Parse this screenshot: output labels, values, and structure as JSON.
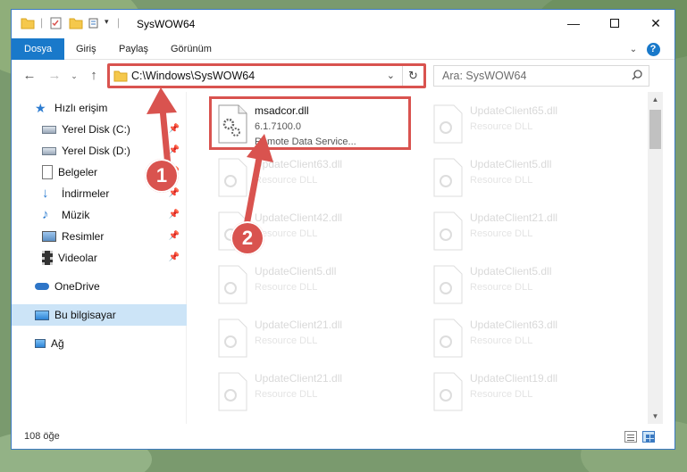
{
  "window": {
    "title": "SysWOW64"
  },
  "ribbon": {
    "tabs": [
      {
        "label": "Dosya",
        "active": true
      },
      {
        "label": "Giriş",
        "active": false
      },
      {
        "label": "Paylaş",
        "active": false
      },
      {
        "label": "Görünüm",
        "active": false
      }
    ]
  },
  "nav": {
    "address": "C:\\Windows\\SysWOW64",
    "search_placeholder": "Ara: SysWOW64"
  },
  "sidebar": {
    "items": [
      {
        "label": "Hızlı erişim",
        "icon": "star-icon",
        "pinned": false
      },
      {
        "label": "Yerel Disk (C:)",
        "icon": "drive-icon",
        "pinned": true
      },
      {
        "label": "Yerel Disk (D:)",
        "icon": "drive-icon",
        "pinned": true
      },
      {
        "label": "Belgeler",
        "icon": "documents-icon",
        "pinned": true
      },
      {
        "label": "İndirmeler",
        "icon": "downloads-icon",
        "pinned": true
      },
      {
        "label": "Müzik",
        "icon": "music-icon",
        "pinned": true
      },
      {
        "label": "Resimler",
        "icon": "pictures-icon",
        "pinned": true
      },
      {
        "label": "Videolar",
        "icon": "videos-icon",
        "pinned": true
      },
      {
        "label": "OneDrive",
        "icon": "cloud-icon",
        "pinned": false
      },
      {
        "label": "Bu bilgisayar",
        "icon": "computer-icon",
        "pinned": false,
        "selected": true
      },
      {
        "label": "Ağ",
        "icon": "network-icon",
        "pinned": false
      }
    ]
  },
  "files": {
    "main": {
      "name": "msadcor.dll",
      "version": "6.1.7100.0",
      "description": "Remote Data Service..."
    },
    "background": [
      {
        "name": "UpdateClient65.dll",
        "type": "Resource DLL"
      },
      {
        "name": "UpdateClient63.dll",
        "type": "Resource DLL"
      },
      {
        "name": "UpdateClient5.dll",
        "type": "Resource DLL"
      },
      {
        "name": "UpdateClient42.dll",
        "type": "Resource DLL"
      },
      {
        "name": "UpdateClient21.dll",
        "type": "Resource DLL"
      },
      {
        "name": "UpdateClient5.dll",
        "type": "Resource DLL"
      },
      {
        "name": "UpdateClient5.dll",
        "type": "Resource DLL"
      },
      {
        "name": "UpdateClient21.dll",
        "type": "Resource DLL"
      },
      {
        "name": "UpdateClient63.dll",
        "type": "Resource DLL"
      },
      {
        "name": "UpdateClient21.dll",
        "type": "Resource DLL"
      },
      {
        "name": "UpdateClient19.dll",
        "type": "Resource DLL"
      }
    ]
  },
  "status": {
    "count": "108 öğe"
  },
  "callouts": {
    "one": "1",
    "two": "2"
  },
  "colors": {
    "accent": "#1979ca",
    "highlight": "#d9534f",
    "selection": "#cce4f7"
  }
}
